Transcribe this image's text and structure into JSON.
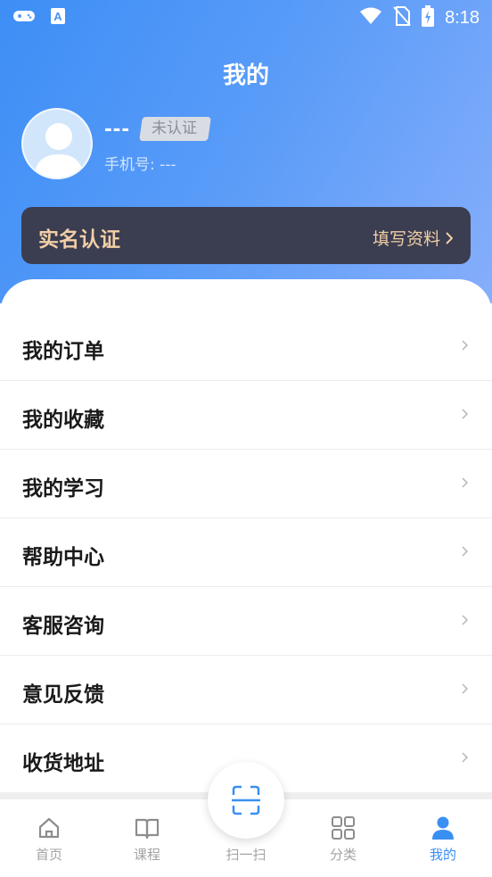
{
  "status_bar": {
    "time": "8:18",
    "icons": [
      "gamepad-icon",
      "a-box-icon",
      "wifi-icon",
      "no-sim-icon",
      "battery-charging-icon"
    ]
  },
  "header": {
    "title": "我的"
  },
  "profile": {
    "name": "---",
    "badge": "未认证",
    "phone_label": "手机号:",
    "phone_value": "---"
  },
  "certification": {
    "title": "实名认证",
    "action": "填写资料"
  },
  "menu": {
    "items": [
      {
        "label": "我的订单"
      },
      {
        "label": "我的收藏"
      },
      {
        "label": "我的学习"
      },
      {
        "label": "帮助中心"
      },
      {
        "label": "客服咨询"
      },
      {
        "label": "意见反馈"
      },
      {
        "label": "收货地址"
      }
    ]
  },
  "tabbar": {
    "tabs": [
      {
        "label": "首页",
        "icon": "home-icon"
      },
      {
        "label": "课程",
        "icon": "book-icon"
      },
      {
        "label": "扫一扫",
        "icon": "scan-icon"
      },
      {
        "label": "分类",
        "icon": "grid-icon"
      },
      {
        "label": "我的",
        "icon": "user-icon",
        "active": true
      }
    ]
  },
  "colors": {
    "primary": "#3a8ff3",
    "cert_bg": "#3b3d50",
    "cert_text": "#f2cfa6"
  }
}
